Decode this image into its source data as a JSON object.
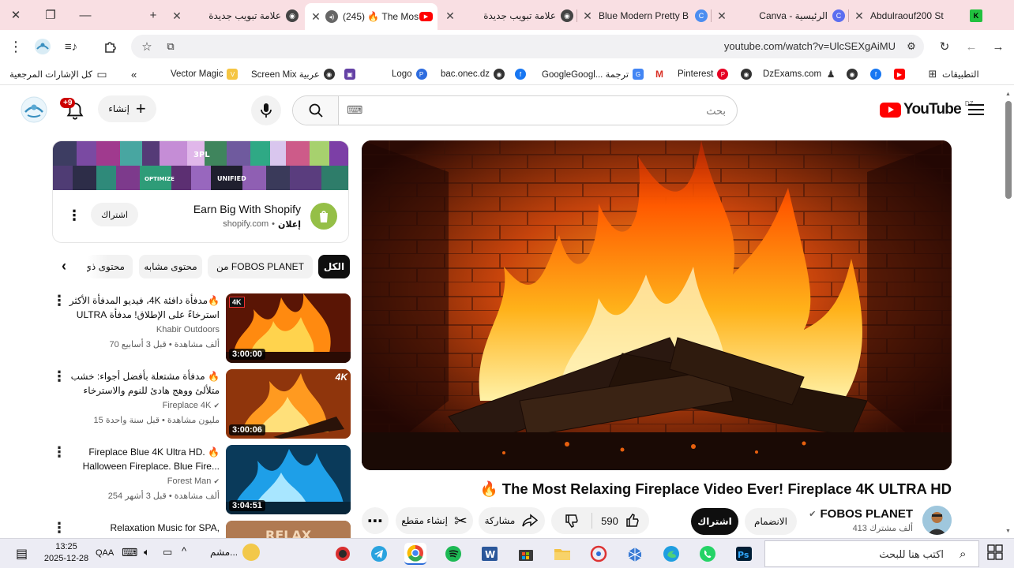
{
  "browser": {
    "tabs": [
      {
        "title": "Abdulraouf200 St",
        "favicon": "letter-k-icon",
        "color": "#21c13f",
        "active": false
      },
      {
        "title": "Canva - الرئيسية",
        "favicon": "canva-icon",
        "color": "#5b6ef0",
        "active": false
      },
      {
        "title": "Blue Modern Pretty B",
        "favicon": "canva-icon",
        "color": "#4b8df0",
        "active": false
      },
      {
        "title": "علامة تبويب جديدة",
        "favicon": "chrome-icon",
        "color": "#444444",
        "active": false
      },
      {
        "title": "(245) 🔥 The Mos",
        "favicon": "youtube-icon",
        "color": "#ff0000",
        "active": true
      },
      {
        "title": "علامة تبويب جديدة",
        "favicon": "chrome-icon",
        "color": "#444444",
        "active": false
      }
    ],
    "url": "youtube.com/watch?v=UlcSEXgAiMU",
    "bookmarks": [
      {
        "label": "التطبيقات",
        "icon": "apps-grid-icon"
      },
      {
        "label": "",
        "icon": "youtube-icon"
      },
      {
        "label": "",
        "icon": "facebook-icon"
      },
      {
        "label": "",
        "icon": "chrome-icon"
      },
      {
        "label": "DzExams.com",
        "icon": "bookmark-icon"
      },
      {
        "label": "",
        "icon": "chrome-icon"
      },
      {
        "label": "Pinterest",
        "icon": "pinterest-icon"
      },
      {
        "label": "",
        "icon": "gmail-icon"
      },
      {
        "label": "GoogleGoogl... ترجمة",
        "icon": "translate-icon"
      },
      {
        "label": "",
        "icon": "facebook-icon"
      },
      {
        "label": "bac.onec.dz",
        "icon": "chrome-icon"
      },
      {
        "label": "Logo",
        "icon": "p-icon"
      },
      {
        "label": "",
        "icon": "twitch-icon"
      },
      {
        "label": "Screen Mix عربية",
        "icon": "chrome-icon"
      },
      {
        "label": "Vector Magic",
        "icon": "vector-magic-icon"
      },
      {
        "label": "كل الإشارات المرجعية",
        "icon": "folder-icon"
      }
    ]
  },
  "youtube": {
    "logo_text": "YouTube",
    "country": "DZ",
    "search_placeholder": "بحث",
    "create_label": "إنشاء",
    "notifications_badge": "+9",
    "video": {
      "title": "The Most Relaxing Fireplace Video Ever! Fireplace 4K ULTRA HD",
      "title_prefix": "🔥",
      "channel": "FOBOS PLANET",
      "subscribers": "413 ألف مشترك",
      "join_label": "الانضمام",
      "subscribe_label": "اشتراك",
      "likes": "590",
      "share_label": "مشاركة",
      "clip_label": "إنشاء مقطع"
    },
    "ad": {
      "title": "Earn Big With Shopify",
      "domain": "shopify.com",
      "ad_label": "إعلان",
      "button": "اشتراك"
    },
    "chips": [
      "الكل",
      "من FOBOS PLANET",
      "محتوى مشابه",
      "محتوى ذي"
    ],
    "recommendations": [
      {
        "title": "🔥مدفأة دافئة 4K، فيديو المدفأة الأكثر استرخاءً على الإطلاق! مدفأة ULTRA K...",
        "channel": "Khabir Outdoors",
        "verified": false,
        "meta": "70 ألف مشاهدة • قبل 3 أسابيع",
        "duration": "3:00:00",
        "badge": "4K ULTRA HD",
        "kind": "fire"
      },
      {
        "title": "🔥 مدفأة مشتعلة بأفضل أجواء: خشب متلألئ ووهج هادئ للنوم والاسترخاء (fireplace)",
        "channel": "Fireplace 4K",
        "verified": true,
        "meta": "15 مليون مشاهدة • قبل سنة واحدة",
        "duration": "3:00:06",
        "badge": "4K",
        "kind": "fire"
      },
      {
        "title": "Fireplace Blue 4K Ultra HD. 🔥 Halloween Fireplace. Blue Fire...",
        "channel": "Forest Man",
        "verified": true,
        "meta": "254 ألف مشاهدة • قبل 3 أشهر",
        "duration": "3:04:51",
        "badge": "",
        "kind": "blue"
      },
      {
        "title": "Relaxation Music for SPA,",
        "channel": "",
        "verified": false,
        "meta": "",
        "duration": "",
        "badge": "",
        "kind": "spa"
      }
    ]
  },
  "taskbar": {
    "search_placeholder": "اكتب هنا للبحث",
    "time": "13:25",
    "date": "2025-12-28",
    "language": "QAA",
    "weather_label": "مشم...",
    "apps": [
      "chrome-icon",
      "telegram-icon",
      "chrome-icon",
      "spotify-icon",
      "word-icon",
      "store-icon",
      "file-explorer-icon",
      "app-icon",
      "edge-icon",
      "whatsapp-icon",
      "photoshop-icon"
    ]
  }
}
